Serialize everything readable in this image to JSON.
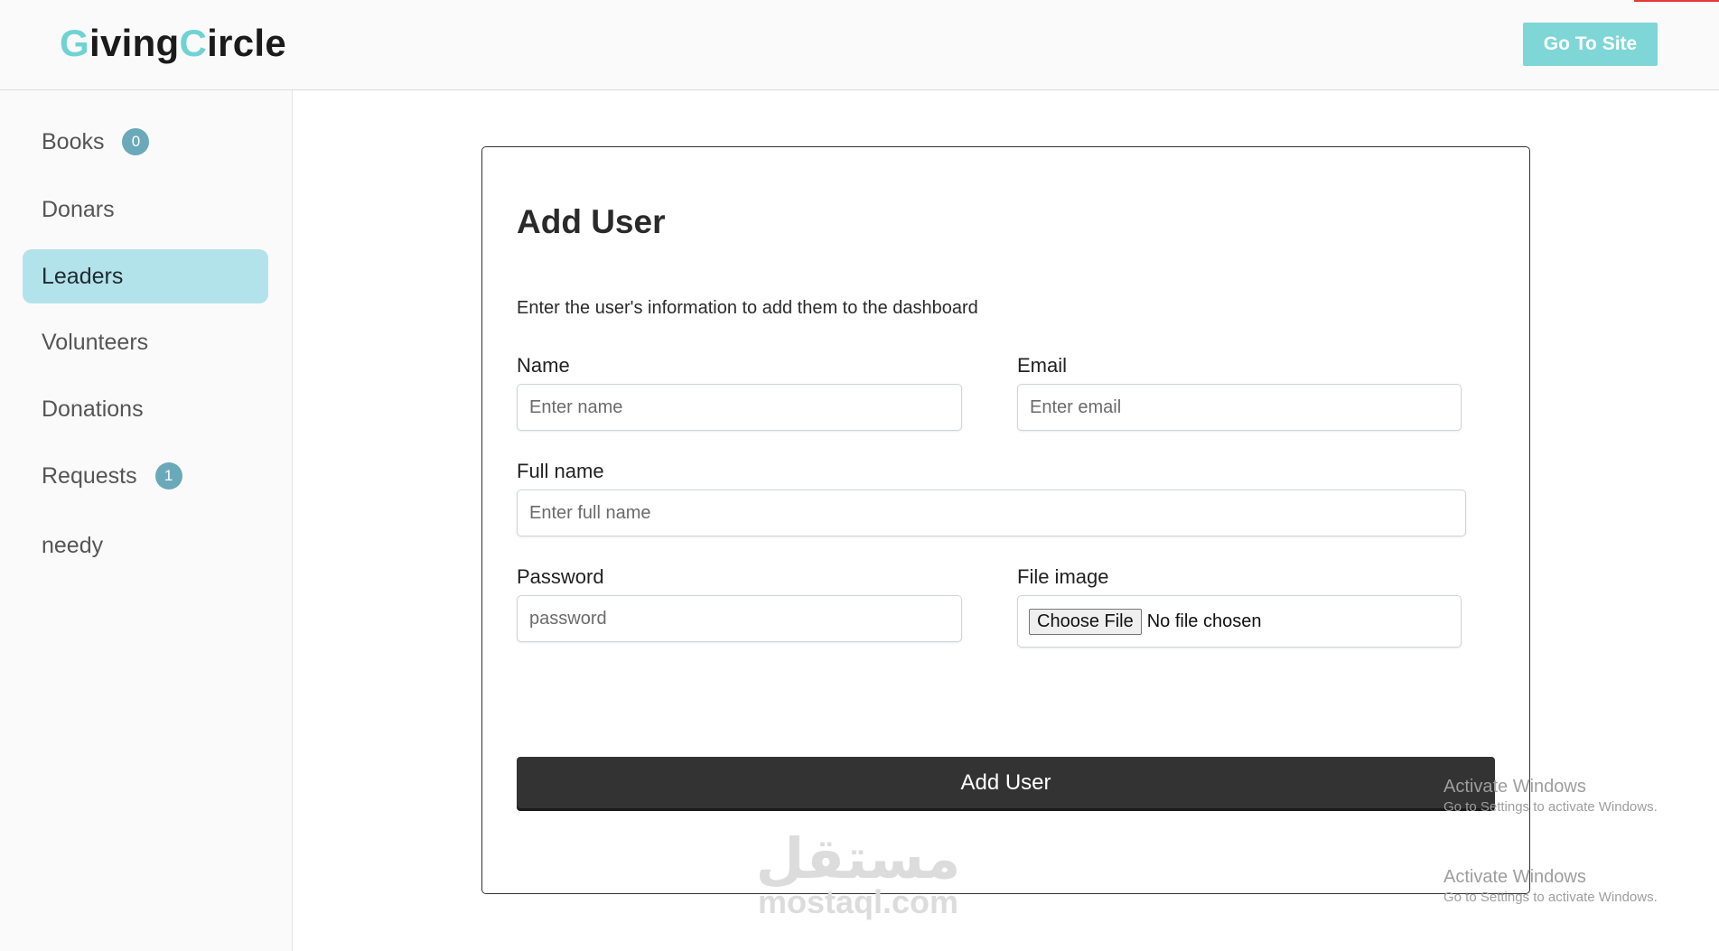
{
  "header": {
    "logo_part1_accent": "G",
    "logo_part1_rest": "iving",
    "logo_part2_accent": "C",
    "logo_part2_rest": "ircle",
    "go_to_site_label": "Go To Site"
  },
  "sidebar": {
    "items": [
      {
        "label": "Books",
        "badge": "0",
        "active": false
      },
      {
        "label": "Donars",
        "active": false
      },
      {
        "label": "Leaders",
        "active": true
      },
      {
        "label": "Volunteers",
        "active": false
      },
      {
        "label": "Donations",
        "active": false
      },
      {
        "label": "Requests",
        "badge": "1",
        "active": false
      },
      {
        "label": "needy",
        "active": false
      }
    ]
  },
  "form": {
    "title": "Add User",
    "description": "Enter the user's information to add them to the dashboard",
    "name": {
      "label": "Name",
      "placeholder": "Enter name",
      "value": ""
    },
    "email": {
      "label": "Email",
      "placeholder": "Enter email",
      "value": ""
    },
    "full_name": {
      "label": "Full name",
      "placeholder": "Enter full name",
      "value": ""
    },
    "password": {
      "label": "Password",
      "placeholder": "password",
      "value": ""
    },
    "file_image": {
      "label": "File image",
      "button_label": "Choose File",
      "status": "No file chosen"
    },
    "submit_label": "Add User"
  },
  "os_overlay": {
    "activate_title": "Activate Windows",
    "activate_sub": "Go to Settings to activate Windows."
  },
  "watermark": {
    "arabic": "مستقل",
    "latin": "mostaql.com"
  },
  "colors": {
    "accent": "#6fd3d3",
    "button_teal": "#7fd6d6",
    "active_nav": "#b3e3ea",
    "badge": "#6aa9b9",
    "submit": "#333333"
  }
}
